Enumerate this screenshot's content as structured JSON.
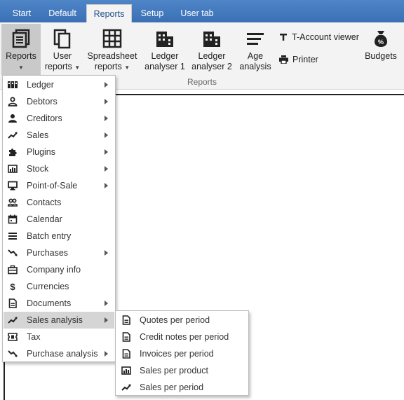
{
  "tabs": [
    {
      "label": "Start",
      "active": false
    },
    {
      "label": "Default",
      "active": false
    },
    {
      "label": "Reports",
      "active": true
    },
    {
      "label": "Setup",
      "active": false
    },
    {
      "label": "User tab",
      "active": false
    }
  ],
  "ribbon": {
    "reports": "Reports",
    "user_reports_1": "User",
    "user_reports_2": "reports",
    "spreadsheet_1": "Spreadsheet",
    "spreadsheet_2": "reports",
    "ledger1_1": "Ledger",
    "ledger1_2": "analyser 1",
    "ledger2_1": "Ledger",
    "ledger2_2": "analyser 2",
    "age_1": "Age",
    "age_2": "analysis",
    "t_account": "T-Account viewer",
    "printer": "Printer",
    "budgets": "Budgets",
    "group_label": "Reports"
  },
  "menu": {
    "items": [
      {
        "label": "Ledger",
        "icon": "ledger-icon",
        "submenu": true
      },
      {
        "label": "Debtors",
        "icon": "person-outline-icon",
        "submenu": true
      },
      {
        "label": "Creditors",
        "icon": "person-filled-icon",
        "submenu": true
      },
      {
        "label": "Sales",
        "icon": "trend-up-icon",
        "submenu": true
      },
      {
        "label": "Plugins",
        "icon": "puzzle-icon",
        "submenu": true
      },
      {
        "label": "Stock",
        "icon": "stock-icon",
        "submenu": true
      },
      {
        "label": "Point-of-Sale",
        "icon": "monitor-icon",
        "submenu": true
      },
      {
        "label": "Contacts",
        "icon": "contacts-icon",
        "submenu": false
      },
      {
        "label": "Calendar",
        "icon": "calendar-icon",
        "submenu": false
      },
      {
        "label": "Batch entry",
        "icon": "list-icon",
        "submenu": false
      },
      {
        "label": "Purchases",
        "icon": "trend-down-icon",
        "submenu": true
      },
      {
        "label": "Company info",
        "icon": "briefcase-icon",
        "submenu": false
      },
      {
        "label": "Currencies",
        "icon": "dollar-icon",
        "submenu": false
      },
      {
        "label": "Documents",
        "icon": "document-icon",
        "submenu": true
      },
      {
        "label": "Sales analysis",
        "icon": "trend-up-icon",
        "submenu": true,
        "highlighted": true
      },
      {
        "label": "Tax",
        "icon": "ticket-icon",
        "submenu": false
      },
      {
        "label": "Purchase analysis",
        "icon": "trend-down-icon",
        "submenu": true
      }
    ]
  },
  "submenu": {
    "items": [
      {
        "label": "Quotes per period",
        "icon": "document-icon"
      },
      {
        "label": "Credit notes per period",
        "icon": "document-icon"
      },
      {
        "label": "Invoices per period",
        "icon": "document-icon"
      },
      {
        "label": "Sales per product",
        "icon": "stock-icon"
      },
      {
        "label": "Sales per period",
        "icon": "trend-up-icon"
      }
    ]
  },
  "colors": {
    "tab_bar": "#3a6fb4",
    "ribbon_bg": "#f3f3f3",
    "menu_hover": "#d5d5d5"
  }
}
